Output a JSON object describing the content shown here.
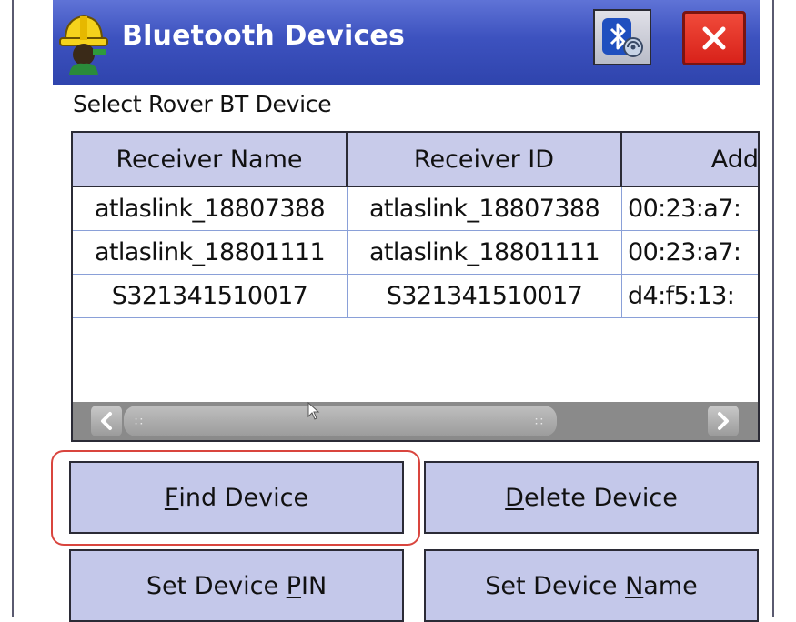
{
  "window": {
    "title": "Bluetooth Devices",
    "app_icon": "surveyor-hardhat-icon",
    "bt_button_icon": "bluetooth-settings-icon",
    "close_label": "X"
  },
  "subtitle": "Select Rover BT Device",
  "table": {
    "columns": [
      "Receiver Name",
      "Receiver ID",
      "Add"
    ],
    "rows": [
      [
        "atlaslink_18807388",
        "atlaslink_18807388",
        "00:23:a7:"
      ],
      [
        "atlaslink_18801111",
        "atlaslink_18801111",
        "00:23:a7:"
      ],
      [
        "S321341510017",
        "S321341510017",
        "d4:f5:13:"
      ]
    ]
  },
  "scrollbar": {
    "left_arrow": "chevron-left-icon",
    "right_arrow": "chevron-right-icon",
    "thumb_position": 0.0
  },
  "buttons": {
    "find": {
      "mnemonic": "F",
      "rest": "ind Device"
    },
    "delete": {
      "mnemonic": "D",
      "rest": "elete Device"
    },
    "set_pin": {
      "before": "Set Device ",
      "mnemonic": "P",
      "after": "IN"
    },
    "set_name": {
      "before": "Set Device ",
      "mnemonic": "N",
      "after": "ame"
    }
  },
  "colors": {
    "titlebar": "#3d52bf",
    "header_bg": "#c4c8ea",
    "close_red": "#d8221a",
    "highlight": "#d9453e"
  }
}
